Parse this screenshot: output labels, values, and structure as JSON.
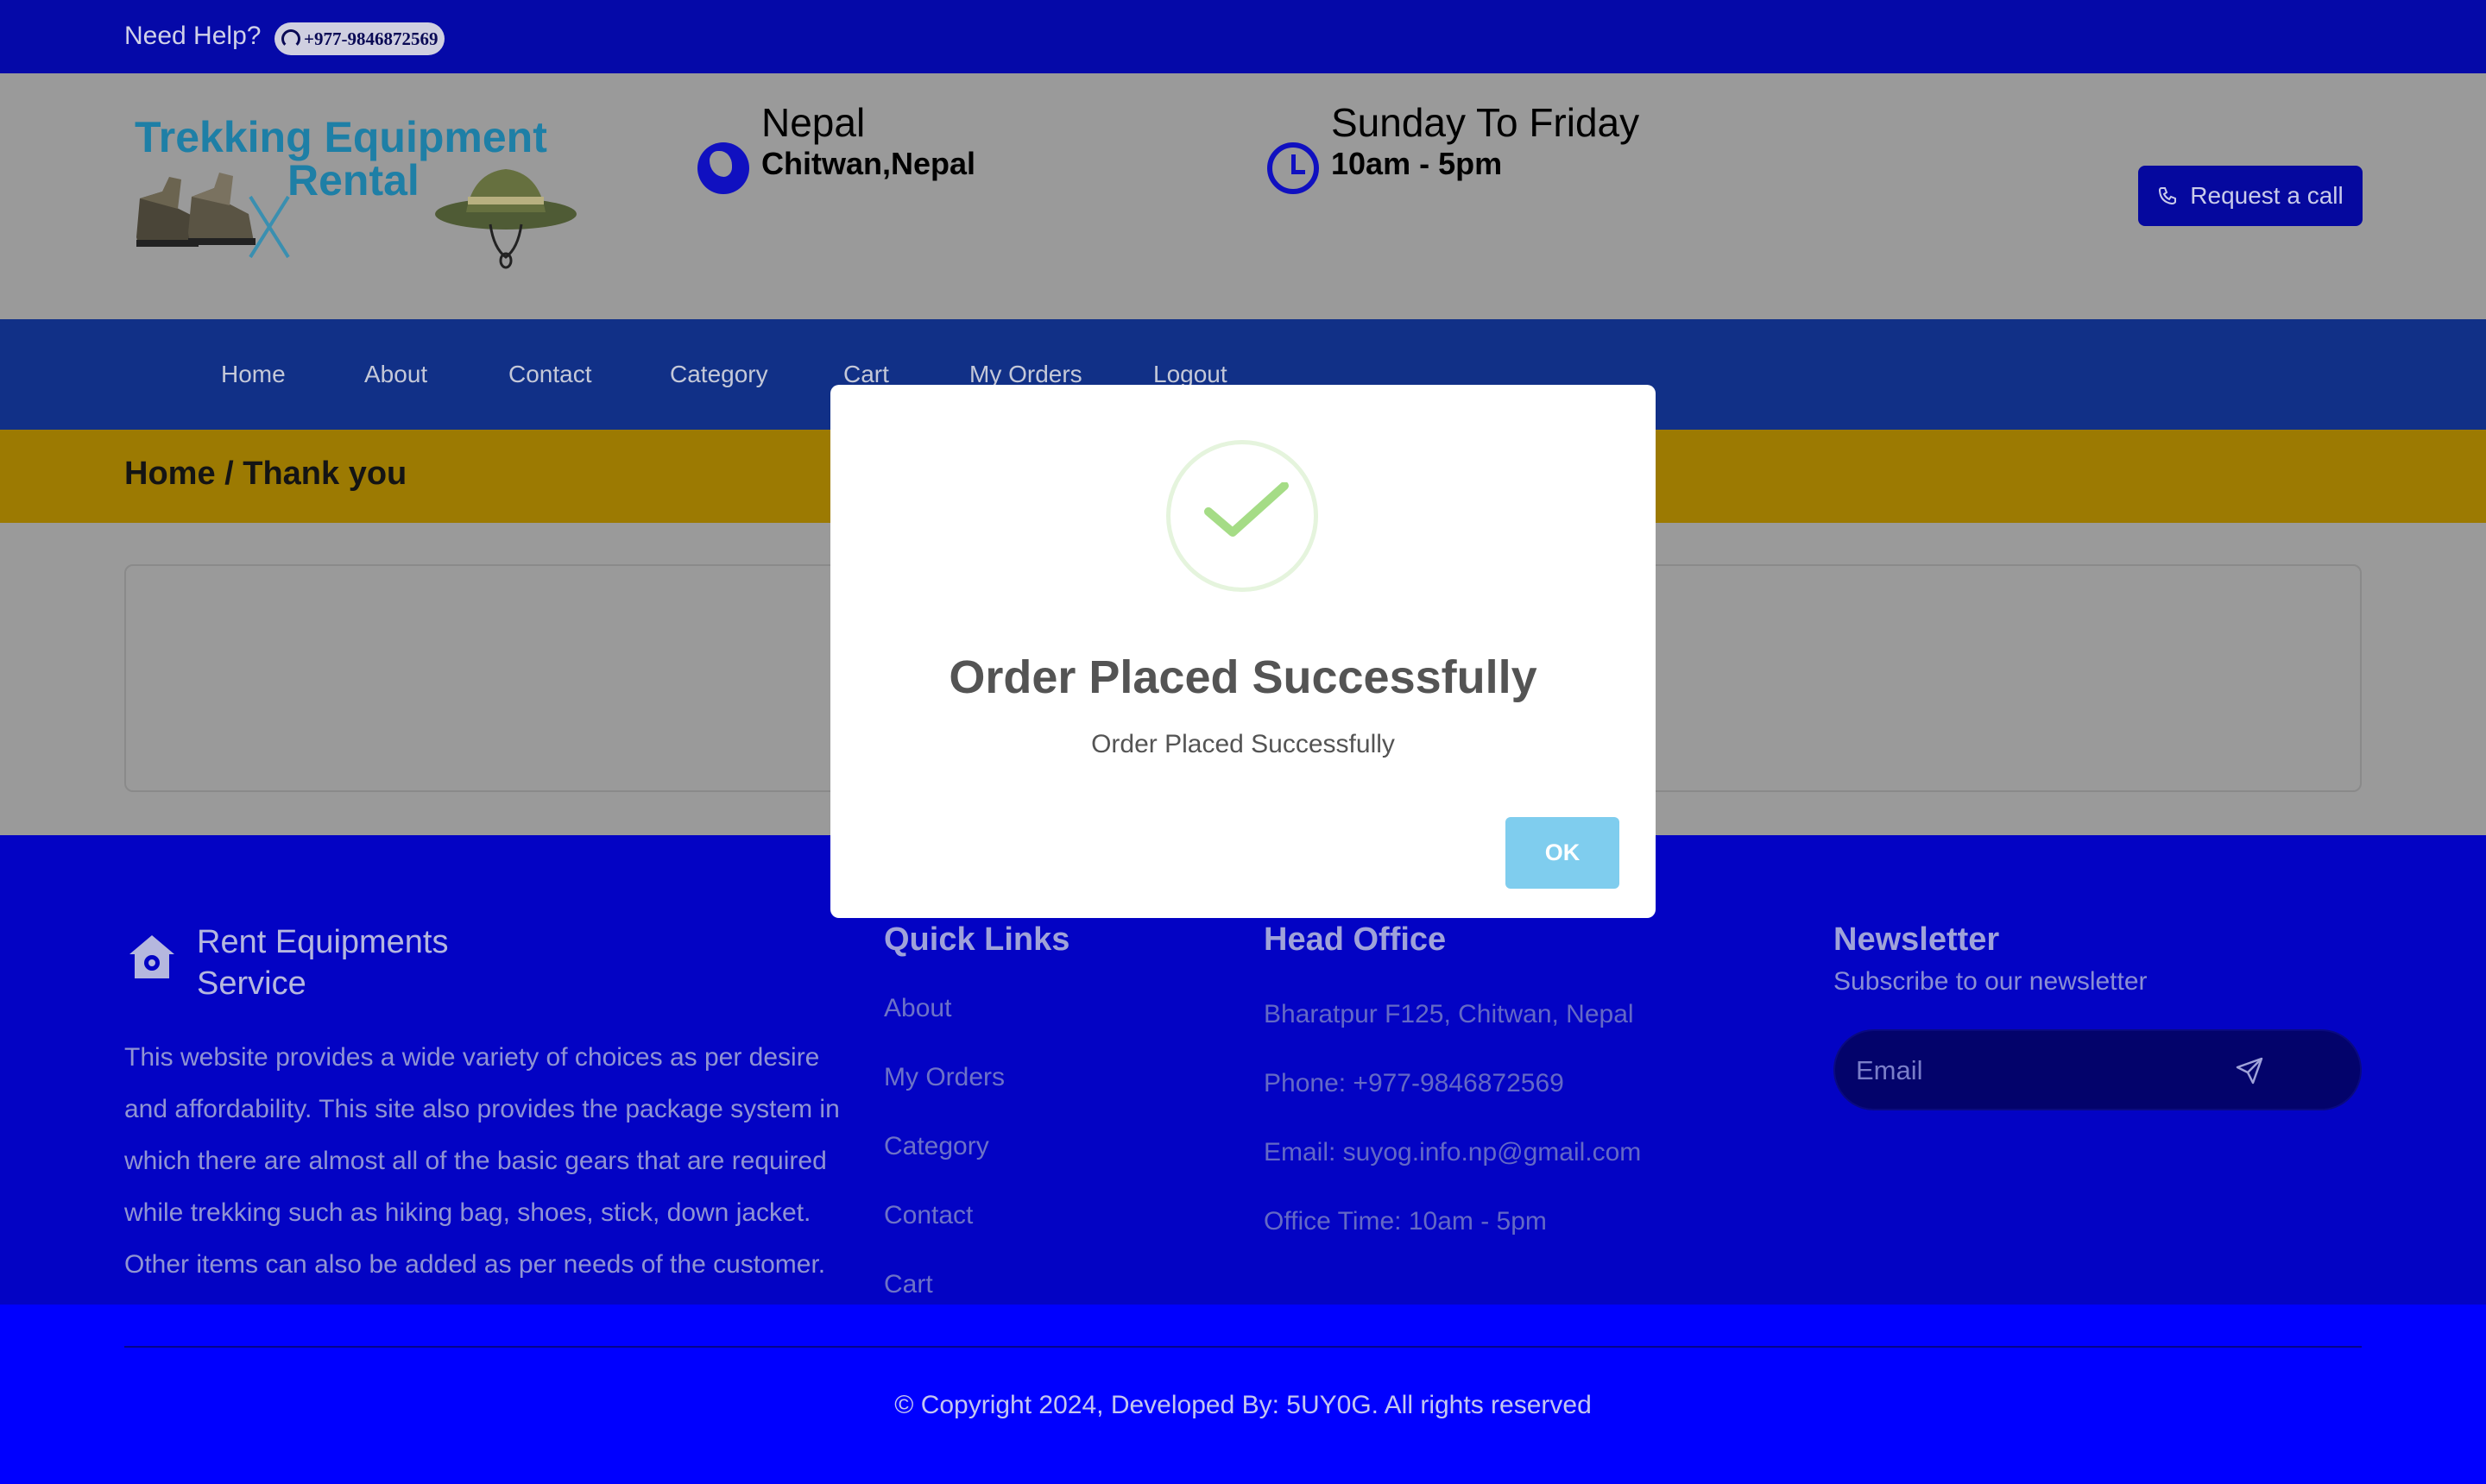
{
  "topbar": {
    "help": "Need Help?",
    "phone": "+977-9846872569"
  },
  "header": {
    "logo_line1": "Trekking Equipment",
    "logo_line2": "Rental",
    "location_title": "Nepal",
    "location_sub": "Chitwan,Nepal",
    "hours_title": "Sunday To Friday",
    "hours_sub": "10am - 5pm",
    "request_call": "Request a call"
  },
  "nav": {
    "items": [
      "Home",
      "About",
      "Contact",
      "Category",
      "Cart",
      "My Orders",
      "Logout"
    ]
  },
  "breadcrumb": "Home / Thank you",
  "footer": {
    "brand_line1": "Rent Equipments",
    "brand_line2": "Service",
    "description": "This website provides a wide variety of choices as per desire and affordability. This site also provides the package system in which there are almost all of the basic gears that are required while trekking such as hiking bag, shoes, stick, down jacket. Other items can also be added as per needs of the customer.",
    "quick_links_title": "Quick Links",
    "quick_links": [
      "About",
      "My Orders",
      "Category",
      "Contact",
      "Cart"
    ],
    "office_title": "Head Office",
    "office_address": "Bharatpur F125, Chitwan, Nepal",
    "office_phone": "Phone: +977-9846872569",
    "office_email": "Email: suyog.info.np@gmail.com",
    "office_time": "Office Time: 10am - 5pm",
    "newsletter_title": "Newsletter",
    "newsletter_sub": "Subscribe to our newsletter",
    "email_placeholder": "Email",
    "copyright": "Copyright 2024, Developed By: 5UY0G. All rights reserved"
  },
  "modal": {
    "title": "Order Placed Successfully",
    "message": "Order Placed Successfully",
    "ok": "OK"
  },
  "colors": {
    "topbar": "#0509a8",
    "nav": "#113087",
    "breadcrumb": "#9c7a02",
    "footer": "#0303c4",
    "copyright_bar": "#0000ff",
    "ok_button": "#7fcdee",
    "success_check": "#a5dc86"
  }
}
